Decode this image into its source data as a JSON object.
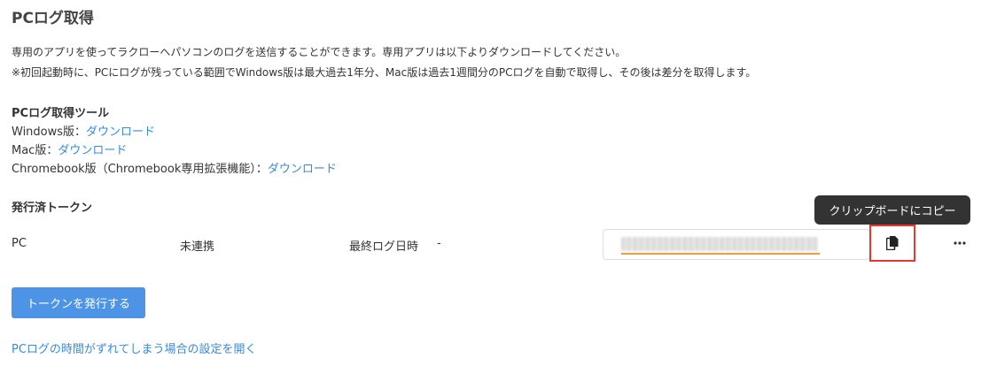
{
  "page_title": "PCログ取得",
  "description": {
    "line1": "専用のアプリを使ってラクローへパソコンのログを送信することができます。専用アプリは以下よりダウンロードしてください。",
    "line2": "※初回起動時に、PCにログが残っている範囲でWindows版は最大過去1年分、Mac版は過去1週間分のPCログを自動で取得し、その後は差分を取得します。"
  },
  "tools": {
    "title": "PCログ取得ツール",
    "items": [
      {
        "label": "Windows版：",
        "link": "ダウンロード"
      },
      {
        "label": "Mac版：",
        "link": "ダウンロード"
      },
      {
        "label": "Chromebook版（Chromebook専用拡張機能）：",
        "link": "ダウンロード"
      }
    ]
  },
  "tokens": {
    "title": "発行済トークン",
    "row": {
      "device": "PC",
      "status": "未連携",
      "last_log_label": "最終ログ日時",
      "last_log_value": "-"
    },
    "copy_tooltip": "クリップボードにコピー",
    "icons": {
      "copy": "copy-icon",
      "more": "more-horizontal-icon"
    }
  },
  "actions": {
    "issue_token": "トークンを発行する",
    "time_settings_link": "PCログの時間がずれてしまう場合の設定を開く"
  },
  "colors": {
    "link": "#3b8ad9",
    "primary_button": "#4d94e6",
    "highlight_border": "#e8382c",
    "token_underline": "#f19a3e",
    "tooltip_bg": "#333333"
  }
}
